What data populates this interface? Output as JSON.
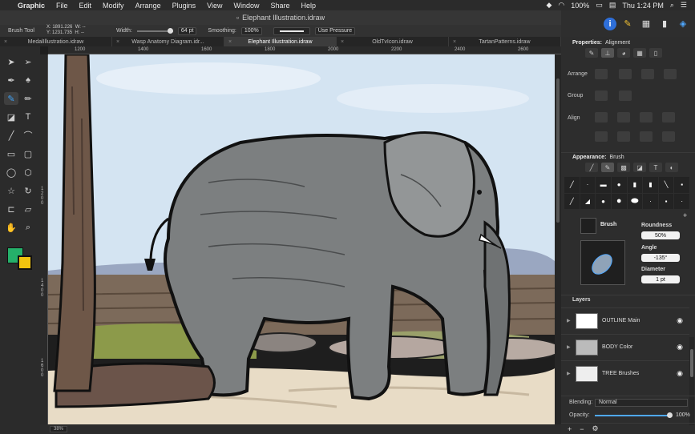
{
  "menubar": {
    "app": "Graphic",
    "items": [
      "File",
      "Edit",
      "Modify",
      "Arrange",
      "Plugins",
      "View",
      "Window",
      "Share",
      "Help"
    ],
    "battery": "100%",
    "clock": "Thu 1:24 PM"
  },
  "window": {
    "title": "Elephant Illustration.idraw"
  },
  "toolbar": {
    "tool_name": "Brush Tool",
    "width_label": "Width:",
    "width_value": "64 pt",
    "smoothing_label": "Smoothing:",
    "smoothing_value": "100%",
    "pressure_label": "Use Pressure"
  },
  "coords": {
    "x": "X: 1891.226",
    "y": "Y: 1231.735",
    "w": "W: --",
    "h": "H: --"
  },
  "tabs": [
    {
      "label": "MedalIllustration.idraw"
    },
    {
      "label": "Wasp Anatomy Diagram.idr..."
    },
    {
      "label": "Elephant Illustration.idraw"
    },
    {
      "label": "OldTvIcon.idraw"
    },
    {
      "label": "TartanPatterns.idraw"
    }
  ],
  "ruler": {
    "h": [
      "1200",
      "1400",
      "1600",
      "1800",
      "2000",
      "2200",
      "2400",
      "2600"
    ],
    "v": [
      "1200",
      "1400",
      "1600"
    ]
  },
  "status": {
    "zoom": "38%"
  },
  "properties": {
    "header": "Properties:",
    "section": "Alignment",
    "arrange_label": "Arrange",
    "group_label": "Group",
    "align_label": "Align"
  },
  "appearance": {
    "header": "Appearance:",
    "section": "Brush",
    "brush_label": "Brush",
    "roundness_label": "Roundness",
    "roundness_value": "50%",
    "angle_label": "Angle",
    "angle_value": "-135°",
    "diameter_label": "Diameter",
    "diameter_value": "1 pt"
  },
  "layers": {
    "header": "Layers",
    "items": [
      {
        "name": "OUTLINE Main"
      },
      {
        "name": "BODY Color"
      },
      {
        "name": "TREE Brushes"
      }
    ],
    "blending_label": "Blending:",
    "blending_value": "Normal",
    "opacity_label": "Opacity:",
    "opacity_value": "100%"
  }
}
